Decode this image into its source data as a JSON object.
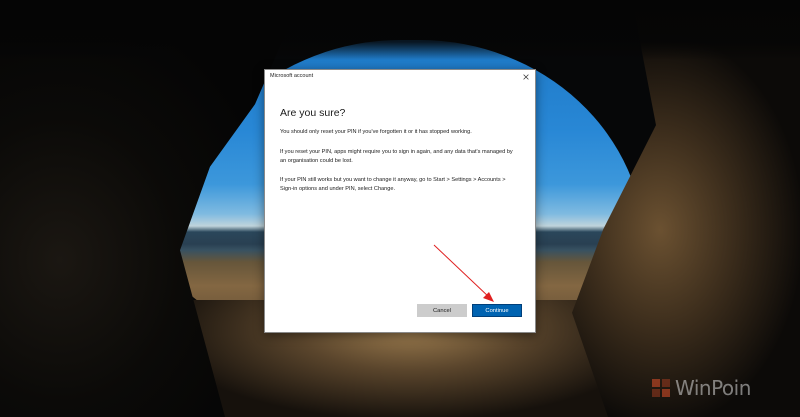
{
  "window": {
    "title": "Microsoft account",
    "close_icon": "close-icon"
  },
  "dialog": {
    "heading": "Are you sure?",
    "messages": [
      "You should only reset your PIN if you've forgotten it or it has stopped working.",
      "If you reset your PIN, apps might require you to sign in again, and any data that's managed by an organisation could be lost.",
      "If your PIN still works but you want to change it anyway, go to Start > Settings > Accounts > Sign-in options and under PIN, select Change."
    ],
    "buttons": {
      "cancel": "Cancel",
      "continue": "Continue"
    }
  },
  "watermark": {
    "text": "WinPoin"
  },
  "colors": {
    "primary_button": "#0063b1",
    "secondary_button": "#cccccc",
    "annotation_arrow": "#e02020",
    "logo": "#e0502a"
  }
}
